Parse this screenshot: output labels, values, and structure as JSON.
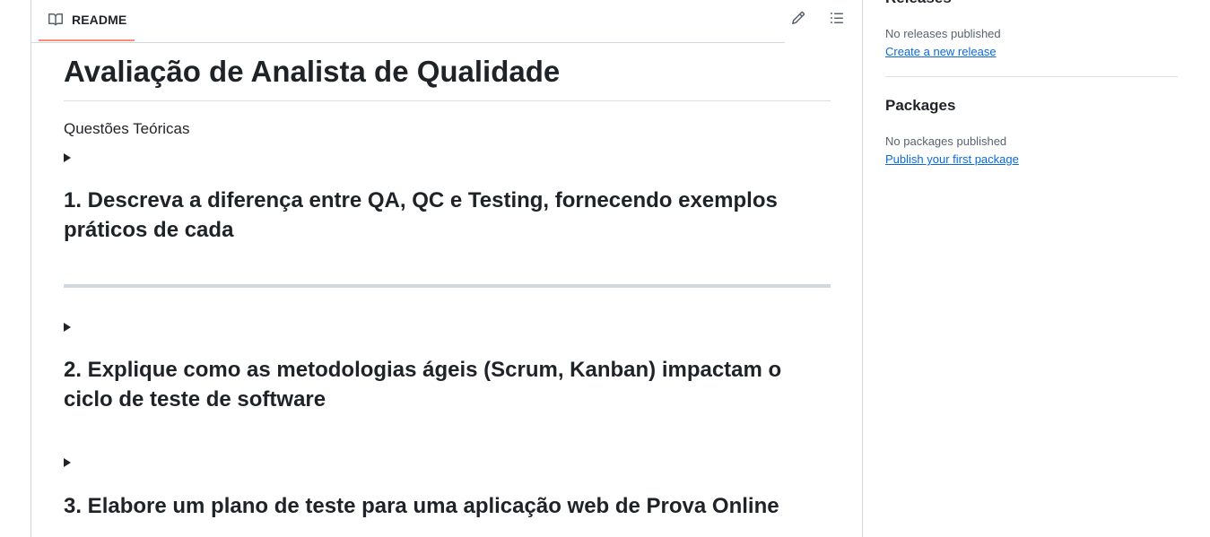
{
  "readme": {
    "tab_label": "README",
    "title": "Avaliação de Analista de Qualidade",
    "intro": "Questões Teóricas",
    "questions": [
      "1. Descreva a diferença entre QA, QC e Testing, fornecendo exemplos práticos de cada",
      "2. Explique como as metodologias ágeis (Scrum, Kanban) impactam o ciclo de teste de software",
      "3. Elabore um plano de teste para uma aplicação web de Prova Online"
    ]
  },
  "sidebar": {
    "releases": {
      "heading": "Releases",
      "status": "No releases published",
      "link": "Create a new release"
    },
    "packages": {
      "heading": "Packages",
      "status": "No packages published",
      "link": "Publish your first package"
    }
  },
  "icons": [
    "book-icon",
    "pencil-icon",
    "list-unordered-icon",
    "triangle-right-icon"
  ],
  "colors": {
    "tab_underline": "#fd8c73",
    "link": "#0969da",
    "muted": "#59636e",
    "border": "#d0d7de"
  }
}
